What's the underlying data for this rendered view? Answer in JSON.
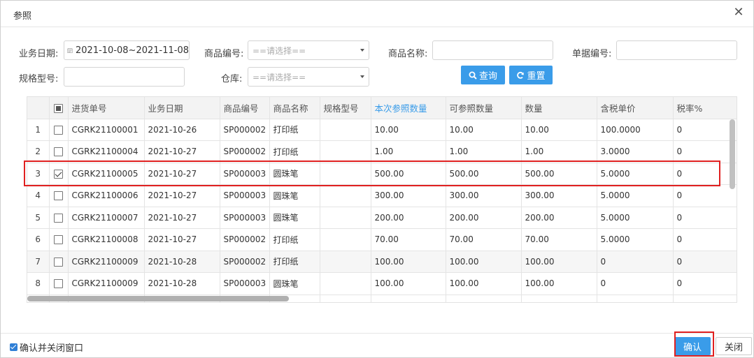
{
  "dialog": {
    "title": "参照",
    "close_glyph": "✕"
  },
  "filters": {
    "date_label": "业务日期:",
    "date_value": "2021-10-08~2021-11-08",
    "product_code_label": "商品编号:",
    "product_code_placeholder": "==请选择==",
    "product_name_label": "商品名称:",
    "product_name_value": "",
    "doc_no_label": "单据编号:",
    "doc_no_value": "",
    "spec_label": "规格型号:",
    "spec_value": "",
    "warehouse_label": "仓库:",
    "warehouse_placeholder": "==请选择==",
    "query_label": "查询",
    "reset_label": "重置"
  },
  "table": {
    "headers": [
      "进货单号",
      "业务日期",
      "商品编号",
      "商品名称",
      "规格型号",
      "本次参照数量",
      "可参照数量",
      "数量",
      "含税单价",
      "税率%"
    ],
    "rows": [
      {
        "num": "1",
        "checked": false,
        "cells": [
          "CGRK21100001",
          "2021-10-26",
          "SP000002",
          "打印纸",
          "",
          "10.00",
          "10.00",
          "10.00",
          "100.0000",
          "0"
        ]
      },
      {
        "num": "2",
        "checked": false,
        "cells": [
          "CGRK21100004",
          "2021-10-27",
          "SP000002",
          "打印纸",
          "",
          "1.00",
          "1.00",
          "1.00",
          "3.0000",
          "0"
        ]
      },
      {
        "num": "3",
        "checked": true,
        "cells": [
          "CGRK21100005",
          "2021-10-27",
          "SP000003",
          "圆珠笔",
          "",
          "500.00",
          "500.00",
          "500.00",
          "5.0000",
          "0"
        ]
      },
      {
        "num": "4",
        "checked": false,
        "cells": [
          "CGRK21100006",
          "2021-10-27",
          "SP000003",
          "圆珠笔",
          "",
          "300.00",
          "300.00",
          "300.00",
          "5.0000",
          "0"
        ]
      },
      {
        "num": "5",
        "checked": false,
        "cells": [
          "CGRK21100007",
          "2021-10-27",
          "SP000003",
          "圆珠笔",
          "",
          "200.00",
          "200.00",
          "200.00",
          "5.0000",
          "0"
        ]
      },
      {
        "num": "6",
        "checked": false,
        "cells": [
          "CGRK21100008",
          "2021-10-27",
          "SP000002",
          "打印纸",
          "",
          "70.00",
          "70.00",
          "70.00",
          "5.0000",
          "0"
        ]
      },
      {
        "num": "7",
        "checked": false,
        "cells": [
          "CGRK21100009",
          "2021-10-28",
          "SP000002",
          "打印纸",
          "",
          "100.00",
          "100.00",
          "100.00",
          "0",
          "0"
        ]
      },
      {
        "num": "8",
        "checked": false,
        "cells": [
          "CGRK21100009",
          "2021-10-28",
          "SP000003",
          "圆珠笔",
          "",
          "100.00",
          "100.00",
          "100.00",
          "0",
          "0"
        ]
      }
    ]
  },
  "footer": {
    "confirm_close_label": "确认并关闭窗口",
    "confirm_label": "确认",
    "close_label": "关闭"
  },
  "colors": {
    "accent": "#3a9ce9",
    "highlight_border": "#e02020"
  }
}
